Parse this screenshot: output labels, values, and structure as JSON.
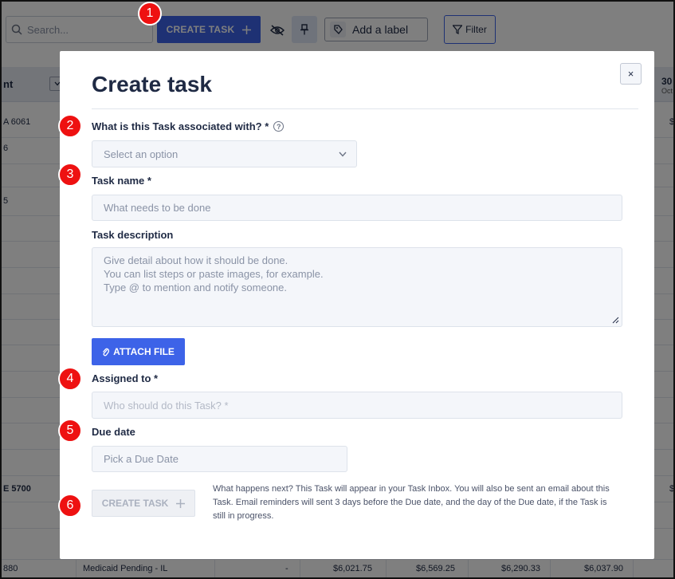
{
  "toolbar": {
    "search_placeholder": "Search...",
    "create_task_label": "CREATE TASK",
    "add_label_text": "Add a label",
    "filter_label": "Filter"
  },
  "table": {
    "header_left": "nt",
    "header_right_day": "30",
    "header_right_month": "Oct",
    "left_cells": [
      "A 6061",
      "6",
      "5",
      "E 5700",
      "880"
    ],
    "right_cells": [
      "$",
      "$"
    ],
    "bottom_row": {
      "status": "Medicaid Pending - IL",
      "dash": "-",
      "v1": "$6,021.75",
      "v2": "$6,569.25",
      "v3": "$6,290.33",
      "v4": "$6,037.90"
    }
  },
  "modal": {
    "title": "Create task",
    "close_glyph": "×",
    "associated_label": "What is this Task associated with? *",
    "associated_help": "?",
    "associated_placeholder": "Select an option",
    "task_name_label": "Task name *",
    "task_name_placeholder": "What needs to be done",
    "description_label": "Task description",
    "description_placeholder": "Give detail about how it should be done.\nYou can list steps or paste images, for example.\nType @ to mention and notify someone.",
    "attach_label": "ATTACH FILE",
    "assigned_label": "Assigned to *",
    "assigned_placeholder": "Who should do this Task? *",
    "due_label": "Due date",
    "due_placeholder": "Pick a Due Date",
    "create_label": "CREATE TASK",
    "note": "What happens next? This Task will appear in your Task Inbox. You will also be sent an email about this Task. Email reminders will sent 3 days before the Due date, and the day of the Due date, if the Task is still in progress."
  },
  "markers": [
    "1",
    "2",
    "3",
    "4",
    "5",
    "6"
  ],
  "colors": {
    "accent": "#3d63e8",
    "marker": "#ee1111",
    "overlay": "rgba(0,0,0,0.5)"
  }
}
